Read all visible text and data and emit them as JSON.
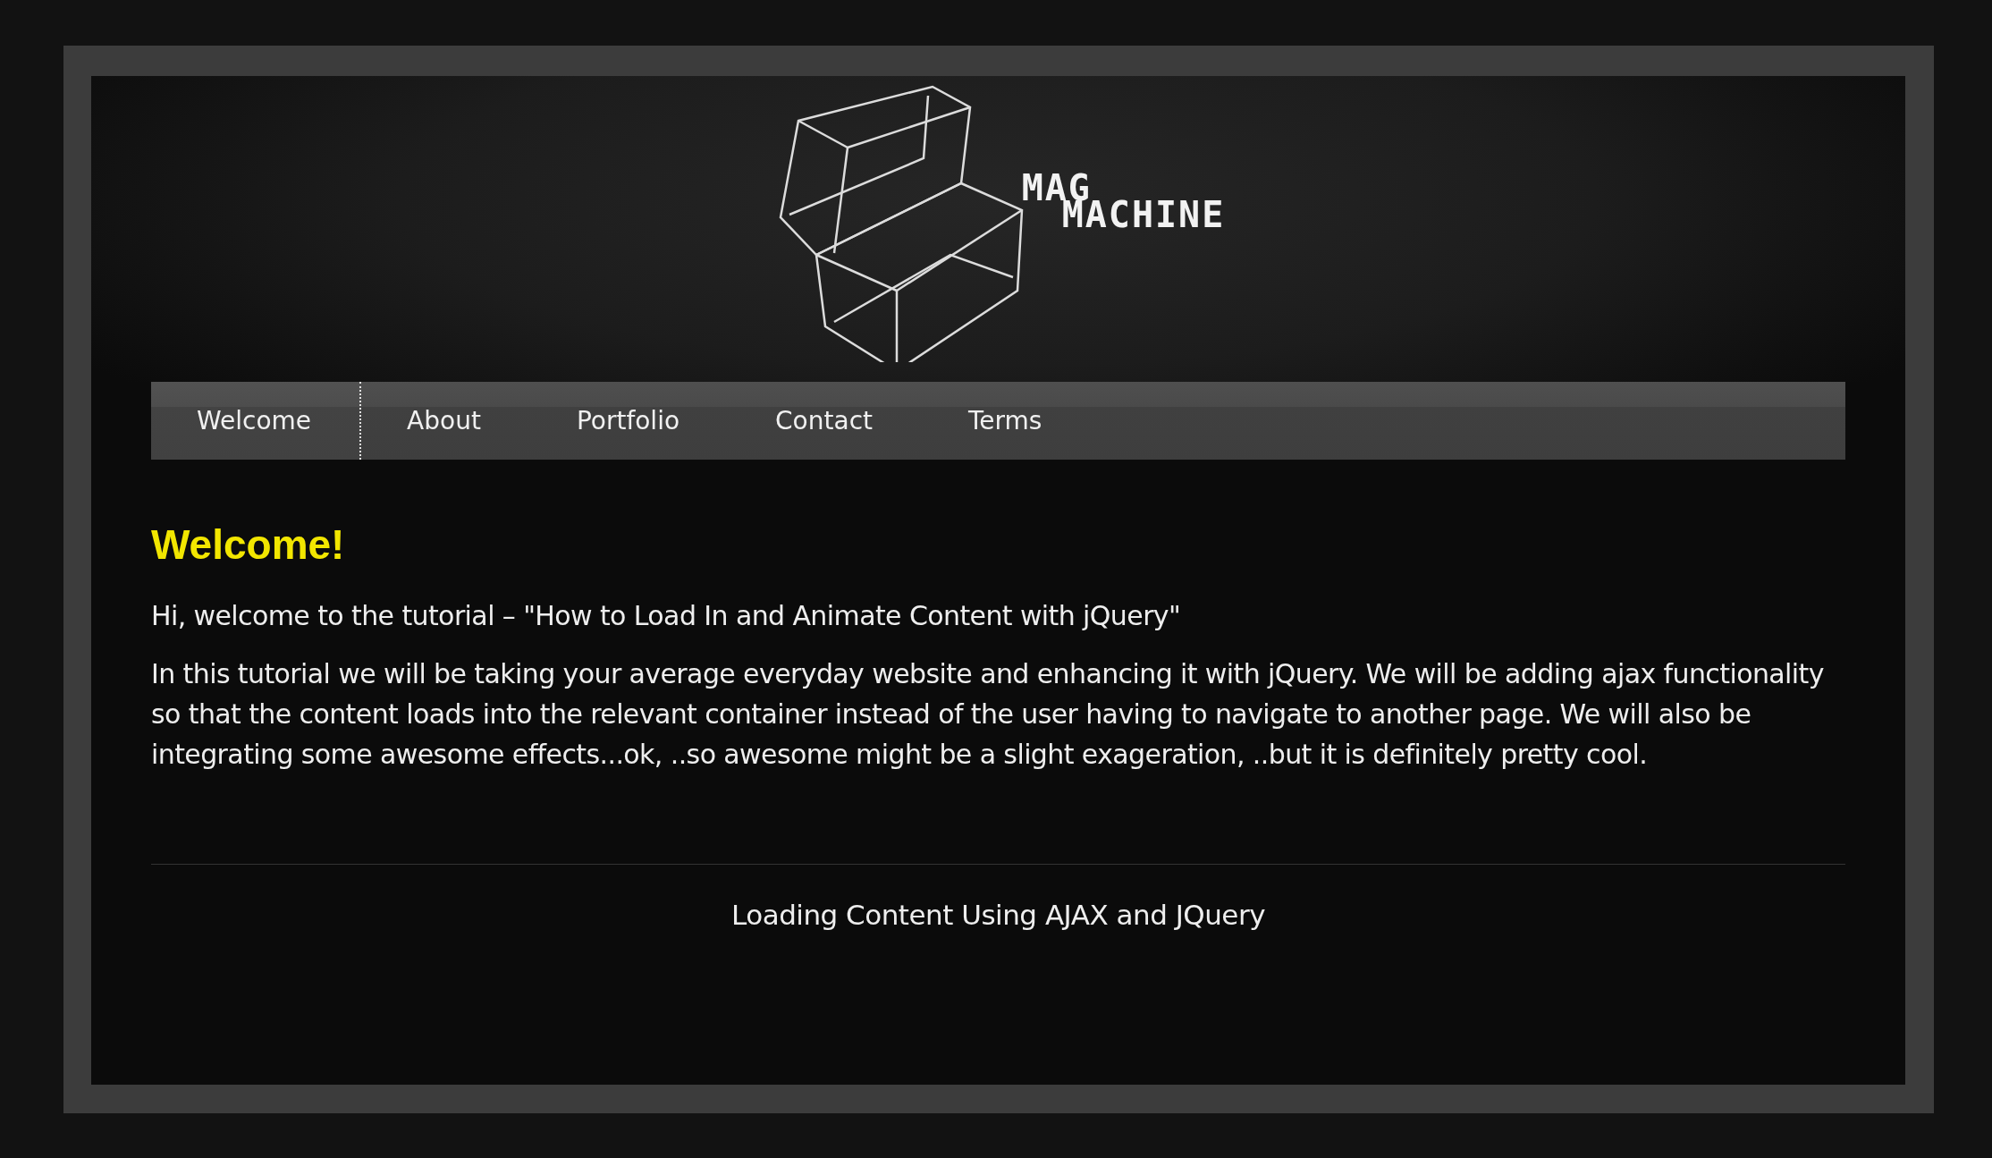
{
  "header": {
    "logo_lines": [
      "MAG",
      "MACHINE"
    ]
  },
  "nav": [
    {
      "label": "Welcome",
      "selected": true
    },
    {
      "label": "About",
      "selected": false
    },
    {
      "label": "Portfolio",
      "selected": false
    },
    {
      "label": "Contact",
      "selected": false
    },
    {
      "label": "Terms",
      "selected": false
    }
  ],
  "content": {
    "heading": "Welcome!",
    "paragraphs": [
      "Hi, welcome to the tutorial – \"How to Load In and Animate Content with jQuery\"",
      "In this tutorial we will be taking your average everyday website and enhancing it with jQuery. We will be adding ajax functionality so that the content loads into the relevant container instead of the user having to navigate to another page. We will also be integrating some awesome effects...ok, ..so awesome might be a slight exageration, ..but it is definitely pretty cool."
    ]
  },
  "footer": {
    "text": "Loading Content Using AJAX and JQuery"
  }
}
